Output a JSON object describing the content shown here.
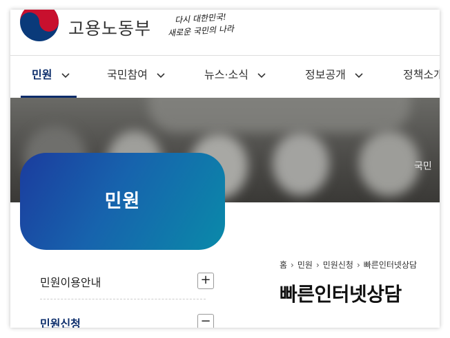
{
  "header": {
    "org_name": "고용노동부",
    "slogan_line1": "다시 대한민국!",
    "slogan_line2": "새로운 국민의 나라"
  },
  "gnb": {
    "items": [
      {
        "label": "민원",
        "active": true
      },
      {
        "label": "국민참여"
      },
      {
        "label": "뉴스·소식"
      },
      {
        "label": "정보공개"
      },
      {
        "label": "정책소개"
      }
    ]
  },
  "hero": {
    "text": "국민"
  },
  "side_menu": {
    "title": "민원",
    "items": [
      {
        "label": "민원이용안내",
        "toggle": "+"
      },
      {
        "label": "민원신청",
        "toggle": "−",
        "selected": true
      }
    ]
  },
  "breadcrumb": [
    "홈",
    "민원",
    "민원신청",
    "빠른인터넷상담"
  ],
  "page_title": "빠른인터넷상담",
  "colors": {
    "brand_navy": "#0c2d6b",
    "side_gradient_start": "#1b3c9e",
    "side_gradient_end": "#0a8aa9",
    "logo_red": "#c8102e",
    "logo_blue": "#0a3a7a"
  }
}
